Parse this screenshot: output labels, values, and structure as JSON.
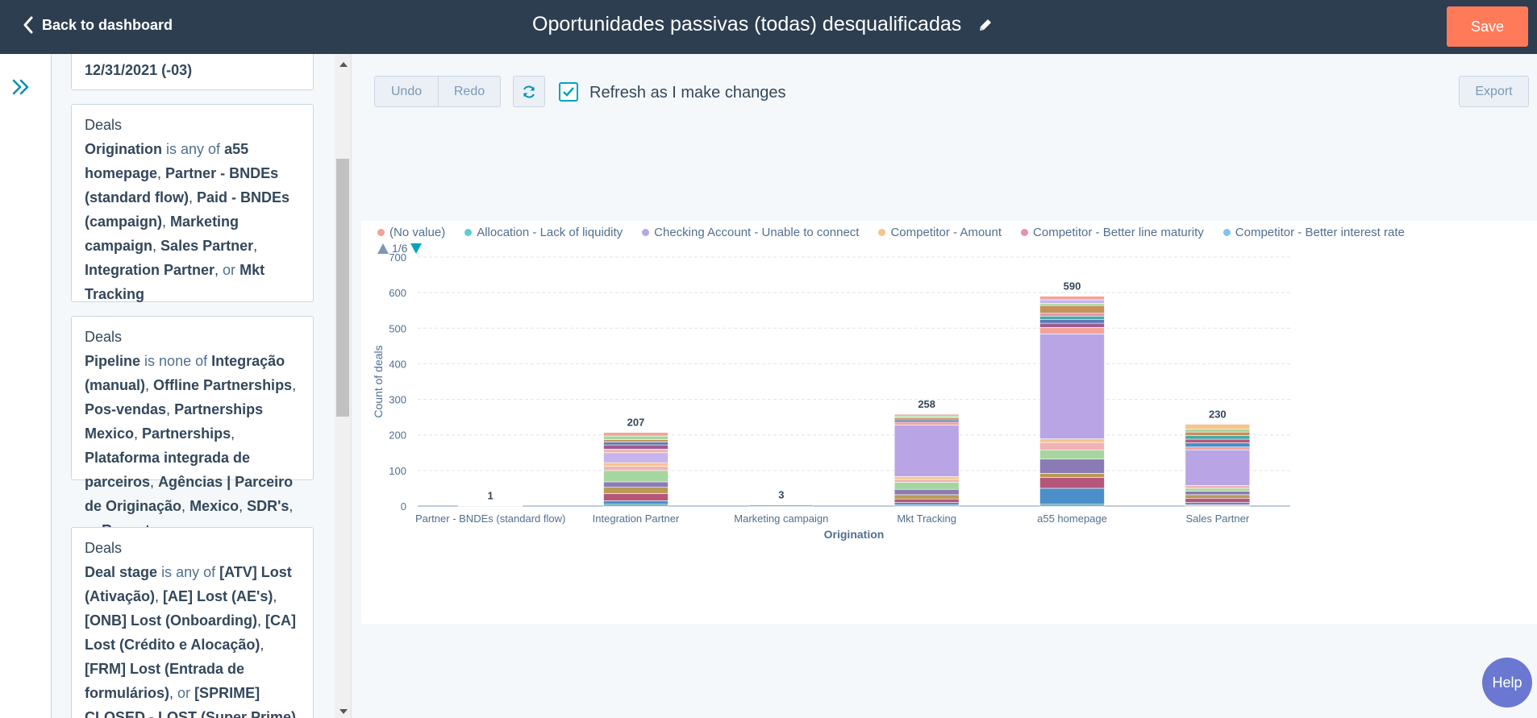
{
  "topbar": {
    "back_label": "Back to dashboard",
    "title": "Oportunidades passivas (todas) desqualificadas",
    "save_label": "Save"
  },
  "filters": {
    "top_fragment": "12/31/2021 (-03)",
    "cards": [
      {
        "category": "Deals",
        "property": "Origination",
        "operator": "is any of",
        "values": [
          "a55 homepage",
          "Partner - BNDEs (standard flow)",
          "Paid - BNDEs (campaign)",
          "Marketing campaign",
          "Sales Partner",
          "Integration Partner"
        ],
        "conjunction": "or",
        "last_value": "Mkt Tracking"
      },
      {
        "category": "Deals",
        "property": "Pipeline",
        "operator": "is none of",
        "values": [
          "Integração (manual)",
          "Offline Partnerships",
          "Pos-vendas",
          "Partnerships Mexico",
          "Partnerships",
          "Plataforma integrada de parceiros",
          "Agências | Parceiro de Originação",
          "Mexico"
        ],
        "conjunction": "or",
        "pre_last": "SDR's",
        "last_value": "Resgate"
      },
      {
        "category": "Deals",
        "property": "Deal stage",
        "operator": "is any of",
        "values": [
          "[ATV] Lost (Ativação)",
          "[AE] Lost (AE's)",
          "[ONB] Lost (Onboarding)",
          "[CA] Lost (Crédito e Alocação)"
        ],
        "pre_last": "[FRM] Lost (Entrada de formulários)",
        "conjunction": "or",
        "last_value": "[SPRIME] CLOSED - LOST (Super Prime)"
      }
    ]
  },
  "toolbar": {
    "undo_label": "Undo",
    "redo_label": "Redo",
    "refresh_label": "Refresh as I make changes",
    "refresh_checked": true,
    "export_label": "Export"
  },
  "chart_data": {
    "type": "bar",
    "stacked": true,
    "legend": [
      {
        "name": "(No value)",
        "color": "#f2a39a"
      },
      {
        "name": "Allocation - Lack of liquidity",
        "color": "#5bcfd1"
      },
      {
        "name": "Checking Account - Unable to connect",
        "color": "#b9a5e6"
      },
      {
        "name": "Competitor - Amount",
        "color": "#f5c48c"
      },
      {
        "name": "Competitor - Better line maturity",
        "color": "#ea90b1"
      },
      {
        "name": "Competitor - Better interest rate",
        "color": "#7fc3f0"
      }
    ],
    "legend_page": "1/6",
    "categories": [
      "Partner - BNDEs (standard flow)",
      "Integration Partner",
      "Marketing campaign",
      "Mkt Tracking",
      "a55 homepage",
      "Sales Partner"
    ],
    "totals": [
      1,
      207,
      3,
      258,
      590,
      230
    ],
    "segments": [
      [
        [
          1,
          "#4a8fc9"
        ]
      ],
      [
        [
          5,
          "#4ca6a5"
        ],
        [
          10,
          "#4a8fc9"
        ],
        [
          20,
          "#b5567a"
        ],
        [
          18,
          "#b99a55"
        ],
        [
          15,
          "#8a7bb5"
        ],
        [
          32,
          "#a5d6a0"
        ],
        [
          12,
          "#f0b3b3"
        ],
        [
          10,
          "#f5c48c"
        ],
        [
          28,
          "#c5b5ec"
        ],
        [
          10,
          "#f0b3b3"
        ],
        [
          12,
          "#9c5c8f"
        ],
        [
          8,
          "#5b78b5"
        ],
        [
          7,
          "#c4925b"
        ],
        [
          10,
          "#a5d6a0"
        ],
        [
          10,
          "#f2a39a"
        ]
      ],
      [
        [
          3,
          "#4a8fc9"
        ]
      ],
      [
        [
          3,
          "#4ca6a5"
        ],
        [
          7,
          "#4a8fc9"
        ],
        [
          10,
          "#b5567a"
        ],
        [
          12,
          "#b99a55"
        ],
        [
          15,
          "#8a7bb5"
        ],
        [
          20,
          "#a5d6a0"
        ],
        [
          8,
          "#f0b3b3"
        ],
        [
          8,
          "#f5c48c"
        ],
        [
          145,
          "#b9a5e6"
        ],
        [
          8,
          "#f2a39a"
        ],
        [
          6,
          "#5b78b5"
        ],
        [
          6,
          "#c4925b"
        ],
        [
          5,
          "#a5d6a0"
        ],
        [
          5,
          "#f2a39a"
        ]
      ],
      [
        [
          5,
          "#4ca6a5"
        ],
        [
          45,
          "#4a8fc9"
        ],
        [
          30,
          "#b5567a"
        ],
        [
          12,
          "#b99a55"
        ],
        [
          40,
          "#8a7bb5"
        ],
        [
          25,
          "#a5d6a0"
        ],
        [
          22,
          "#f0b3b3"
        ],
        [
          10,
          "#f5c48c"
        ],
        [
          295,
          "#b9a5e6"
        ],
        [
          18,
          "#f2a39a"
        ],
        [
          12,
          "#9c5c8f"
        ],
        [
          10,
          "#5b78b5"
        ],
        [
          10,
          "#4ca6a5"
        ],
        [
          8,
          "#ea90b1"
        ],
        [
          22,
          "#c4925b"
        ],
        [
          6,
          "#a5d6a0"
        ],
        [
          10,
          "#c5b5ec"
        ],
        [
          10,
          "#f2a39a"
        ]
      ],
      [
        [
          4,
          "#f2a39a"
        ],
        [
          6,
          "#4a8fc9"
        ],
        [
          12,
          "#b5567a"
        ],
        [
          10,
          "#b99a55"
        ],
        [
          10,
          "#8a7bb5"
        ],
        [
          8,
          "#a5d6a0"
        ],
        [
          8,
          "#f0b3b3"
        ],
        [
          100,
          "#b9a5e6"
        ],
        [
          8,
          "#f2a39a"
        ],
        [
          12,
          "#4a8fc9"
        ],
        [
          10,
          "#b5567a"
        ],
        [
          10,
          "#4ca6a5"
        ],
        [
          10,
          "#c4925b"
        ],
        [
          8,
          "#a5d6a0"
        ],
        [
          14,
          "#f5c48c"
        ]
      ]
    ],
    "ylabel": "Count of deals",
    "xlabel": "Origination",
    "ylim": [
      0,
      700
    ],
    "yticks": [
      0,
      100,
      200,
      300,
      400,
      500,
      600,
      700
    ],
    "grid": true
  },
  "help_label": "Help"
}
